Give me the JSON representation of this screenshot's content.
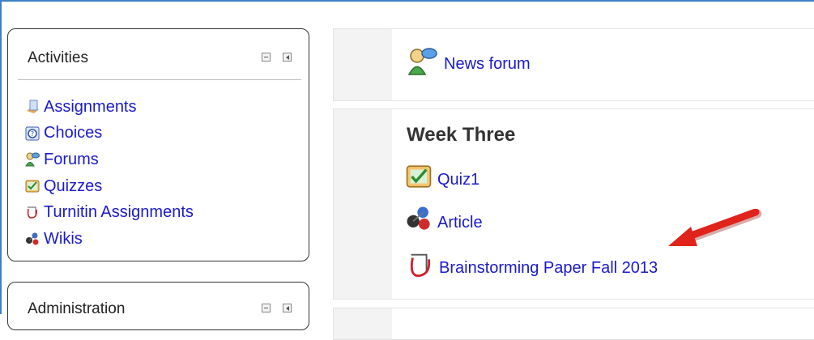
{
  "activities_block": {
    "title": "Activities",
    "items": [
      {
        "label": "Assignments",
        "icon": "assignment-icon"
      },
      {
        "label": "Choices",
        "icon": "choice-icon"
      },
      {
        "label": "Forums",
        "icon": "forum-icon"
      },
      {
        "label": "Quizzes",
        "icon": "quiz-icon"
      },
      {
        "label": "Turnitin Assignments",
        "icon": "turnitin-icon"
      },
      {
        "label": "Wikis",
        "icon": "wiki-icon"
      }
    ]
  },
  "administration_block": {
    "title": "Administration"
  },
  "course": {
    "news_forum": {
      "label": "News forum",
      "icon": "forum-icon"
    },
    "week_three": {
      "title": "Week Three",
      "activities": [
        {
          "label": "Quiz1",
          "icon": "quiz-icon"
        },
        {
          "label": "Article",
          "icon": "wiki-icon"
        },
        {
          "label": "Brainstorming Paper Fall 2013",
          "icon": "turnitin-icon"
        }
      ]
    }
  },
  "colors": {
    "link": "#1a1acc",
    "arrow": "#e0231b",
    "frame": "#3f7fc9"
  }
}
